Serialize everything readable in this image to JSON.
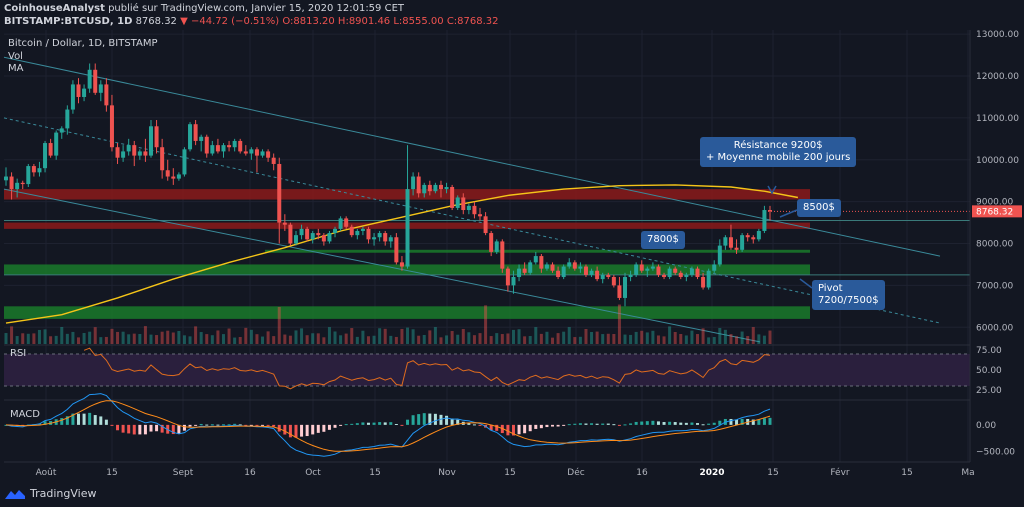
{
  "header": {
    "line1_author": "CoinhouseAnalyst",
    "line1_rest": "publié sur TradingView.com, Janvier 15, 2020 12:01:59 CET",
    "line2_symbol": "BITSTAMP:BTCUSD, 1D",
    "line2_last": "8768.32",
    "line2_change": "−44.72 (−0.51%)",
    "line2_ohlc": "O:8813.20 H:8901.46 L:8555.00 C:8768.32"
  },
  "legend": {
    "title": "Bitcoin / Dollar, 1D, BITSTAMP",
    "vol": "Vol",
    "ma": "MA",
    "rsi": "RSI",
    "macd": "MACD"
  },
  "price_label": "8768.32",
  "callouts": {
    "resistance_line1": "Résistance 9200$",
    "resistance_line2": "+ Moyenne mobile 200 jours",
    "r8500": "8500$",
    "r7800": "7800$",
    "pivot_line1": "Pivot",
    "pivot_line2": "7200/7500$"
  },
  "brand": "TradingView",
  "colors": {
    "background": "#131722",
    "up": "#26a69a",
    "down": "#ef5350",
    "ma200": "#f5c518",
    "resistance_zone": "#8b1a1a",
    "support_zone": "#1a7a2a",
    "rsi_line": "#e06c1e",
    "rsi_band": "#2a1f3d",
    "macd_line": "#2196f3",
    "signal_line": "#ff8c1a",
    "callout": "#2a5a9a"
  },
  "chart_data": [
    {
      "type": "candlestick",
      "title": "Bitcoin / Dollar, 1D, BITSTAMP",
      "x_ticks": [
        "Août",
        "15",
        "Sept",
        "16",
        "Oct",
        "15",
        "Nov",
        "15",
        "Déc",
        "16",
        "2020",
        "15",
        "Févr",
        "15",
        "Ma"
      ],
      "y_ticks": [
        6000,
        7000,
        8000,
        9000,
        10000,
        11000,
        12000,
        13000
      ],
      "ylim": [
        5600,
        13100
      ],
      "series": [
        {
          "name": "BTCUSD",
          "values": [
            [
              9510,
              9820,
              9380,
              9600
            ],
            [
              9600,
              9700,
              9050,
              9300
            ],
            [
              9300,
              9550,
              9100,
              9450
            ],
            [
              9450,
              9500,
              9300,
              9420
            ],
            [
              9420,
              9900,
              9350,
              9850
            ],
            [
              9850,
              9900,
              9600,
              9700
            ],
            [
              9700,
              9950,
              9600,
              9800
            ],
            [
              9800,
              10450,
              9700,
              10400
            ],
            [
              10400,
              10500,
              10050,
              10100
            ],
            [
              10100,
              10700,
              10000,
              10650
            ],
            [
              10650,
              10800,
              10500,
              10750
            ],
            [
              10750,
              11300,
              10600,
              11200
            ],
            [
              11200,
              11900,
              11100,
              11800
            ],
            [
              11800,
              11950,
              11350,
              11500
            ],
            [
              11500,
              11800,
              11400,
              11700
            ],
            [
              11700,
              12300,
              11600,
              12150
            ],
            [
              12150,
              12300,
              11550,
              11600
            ],
            [
              11600,
              11900,
              11400,
              11800
            ],
            [
              11800,
              11950,
              11150,
              11300
            ],
            [
              11300,
              11550,
              10200,
              10300
            ],
            [
              10300,
              10400,
              9900,
              10050
            ],
            [
              10050,
              10350,
              9950,
              10200
            ],
            [
              10200,
              10500,
              10100,
              10350
            ],
            [
              10350,
              10450,
              9850,
              10100
            ],
            [
              10100,
              10250,
              10000,
              10200
            ],
            [
              10200,
              10500,
              9950,
              10100
            ],
            [
              10100,
              10950,
              10050,
              10800
            ],
            [
              10800,
              10950,
              10150,
              10300
            ],
            [
              10300,
              10500,
              9550,
              9750
            ],
            [
              9750,
              10000,
              9500,
              9600
            ],
            [
              9600,
              9800,
              9400,
              9550
            ],
            [
              9550,
              9700,
              9500,
              9650
            ],
            [
              9650,
              10300,
              9600,
              10250
            ],
            [
              10250,
              10900,
              10200,
              10850
            ],
            [
              10850,
              10950,
              10350,
              10450
            ],
            [
              10450,
              10600,
              10200,
              10550
            ],
            [
              10550,
              10600,
              10050,
              10150
            ],
            [
              10150,
              10450,
              10100,
              10350
            ],
            [
              10350,
              10500,
              10150,
              10200
            ],
            [
              10200,
              10400,
              10050,
              10350
            ],
            [
              10350,
              10450,
              10200,
              10300
            ],
            [
              10300,
              10500,
              10200,
              10450
            ],
            [
              10450,
              10500,
              10150,
              10200
            ],
            [
              10200,
              10350,
              10100,
              10150
            ],
            [
              10150,
              10300,
              10000,
              10250
            ],
            [
              10250,
              10300,
              9700,
              10100
            ],
            [
              10100,
              10250,
              10050,
              10200
            ],
            [
              10200,
              10250,
              9950,
              10050
            ],
            [
              10050,
              10150,
              9750,
              9900
            ],
            [
              9900,
              10050,
              8000,
              8500
            ],
            [
              8500,
              8700,
              8300,
              8450
            ],
            [
              8450,
              8500,
              7950,
              8000
            ],
            [
              8000,
              8300,
              7950,
              8200
            ],
            [
              8200,
              8450,
              8100,
              8350
            ],
            [
              8350,
              8400,
              8050,
              8100
            ],
            [
              8100,
              8300,
              8000,
              8250
            ],
            [
              8250,
              8350,
              8100,
              8200
            ],
            [
              8200,
              8250,
              7950,
              8050
            ],
            [
              8050,
              8300,
              8000,
              8250
            ],
            [
              8250,
              8400,
              8150,
              8350
            ],
            [
              8350,
              8650,
              8300,
              8600
            ],
            [
              8600,
              8650,
              8350,
              8400
            ],
            [
              8400,
              8450,
              8150,
              8200
            ],
            [
              8200,
              8350,
              8100,
              8300
            ],
            [
              8300,
              8400,
              8200,
              8350
            ],
            [
              8350,
              8400,
              8000,
              8100
            ],
            [
              8100,
              8250,
              7950,
              8150
            ],
            [
              8150,
              8300,
              8050,
              8250
            ],
            [
              8250,
              8300,
              7950,
              8050
            ],
            [
              8050,
              8200,
              7900,
              8150
            ],
            [
              8150,
              8250,
              7500,
              7550
            ],
            [
              7550,
              7700,
              7350,
              7450
            ],
            [
              7450,
              10350,
              7400,
              9300
            ],
            [
              9300,
              9700,
              9150,
              9600
            ],
            [
              9600,
              9700,
              9100,
              9200
            ],
            [
              9200,
              9450,
              9100,
              9400
            ],
            [
              9400,
              9500,
              9150,
              9250
            ],
            [
              9250,
              9450,
              9200,
              9400
            ],
            [
              9400,
              9500,
              9100,
              9300
            ],
            [
              9300,
              9450,
              9200,
              9350
            ],
            [
              9350,
              9400,
              8800,
              8850
            ],
            [
              8850,
              9150,
              8800,
              9100
            ],
            [
              9100,
              9200,
              8700,
              8800
            ],
            [
              8800,
              8950,
              8700,
              8900
            ],
            [
              8900,
              9000,
              8600,
              8700
            ],
            [
              8700,
              8850,
              8550,
              8650
            ],
            [
              8650,
              8750,
              8200,
              8250
            ],
            [
              8250,
              8300,
              7700,
              7800
            ],
            [
              7800,
              8100,
              7750,
              8050
            ],
            [
              8050,
              8100,
              7300,
              7400
            ],
            [
              7400,
              7450,
              6850,
              7000
            ],
            [
              7000,
              7350,
              6800,
              7200
            ],
            [
              7200,
              7500,
              7100,
              7400
            ],
            [
              7400,
              7550,
              7250,
              7300
            ],
            [
              7300,
              7600,
              7250,
              7550
            ],
            [
              7550,
              7800,
              7500,
              7700
            ],
            [
              7700,
              7750,
              7300,
              7400
            ],
            [
              7400,
              7550,
              7350,
              7500
            ],
            [
              7500,
              7550,
              7300,
              7350
            ],
            [
              7350,
              7450,
              7150,
              7200
            ],
            [
              7200,
              7500,
              7150,
              7450
            ],
            [
              7450,
              7650,
              7400,
              7550
            ],
            [
              7550,
              7600,
              7350,
              7400
            ],
            [
              7400,
              7550,
              7300,
              7450
            ],
            [
              7450,
              7500,
              7200,
              7250
            ],
            [
              7250,
              7400,
              7200,
              7350
            ],
            [
              7350,
              7450,
              7100,
              7150
            ],
            [
              7150,
              7300,
              7050,
              7250
            ],
            [
              7250,
              7300,
              7150,
              7200
            ],
            [
              7200,
              7250,
              6950,
              7000
            ],
            [
              7000,
              7200,
              6650,
              6700
            ],
            [
              6700,
              7300,
              6500,
              7200
            ],
            [
              7200,
              7350,
              7100,
              7250
            ],
            [
              7250,
              7550,
              7200,
              7500
            ],
            [
              7500,
              7600,
              7300,
              7350
            ],
            [
              7350,
              7450,
              7200,
              7400
            ],
            [
              7400,
              7550,
              7350,
              7450
            ],
            [
              7450,
              7500,
              7200,
              7250
            ],
            [
              7250,
              7300,
              7150,
              7200
            ],
            [
              7200,
              7450,
              7150,
              7400
            ],
            [
              7400,
              7450,
              7250,
              7300
            ],
            [
              7300,
              7350,
              7150,
              7200
            ],
            [
              7200,
              7300,
              7100,
              7250
            ],
            [
              7250,
              7450,
              7200,
              7400
            ],
            [
              7400,
              7450,
              7150,
              7200
            ],
            [
              7200,
              7300,
              6900,
              6950
            ],
            [
              6950,
              7400,
              6900,
              7350
            ],
            [
              7350,
              7600,
              7300,
              7500
            ],
            [
              7500,
              8100,
              7450,
              7950
            ],
            [
              7950,
              8200,
              7850,
              8150
            ],
            [
              8150,
              8450,
              7850,
              7900
            ],
            [
              7900,
              8100,
              7750,
              7850
            ],
            [
              7850,
              8250,
              7800,
              8200
            ],
            [
              8200,
              8250,
              8050,
              8150
            ],
            [
              8150,
              8200,
              8000,
              8100
            ],
            [
              8100,
              8350,
              8050,
              8300
            ],
            [
              8300,
              8900,
              8250,
              8800
            ],
            [
              8800,
              8900,
              8550,
              8768
            ]
          ]
        }
      ],
      "ma200": [
        [
          0,
          6100
        ],
        [
          10,
          6300
        ],
        [
          20,
          6700
        ],
        [
          30,
          7150
        ],
        [
          40,
          7550
        ],
        [
          50,
          7900
        ],
        [
          60,
          8300
        ],
        [
          70,
          8600
        ],
        [
          80,
          8900
        ],
        [
          90,
          9150
        ],
        [
          100,
          9300
        ],
        [
          110,
          9380
        ],
        [
          120,
          9400
        ],
        [
          130,
          9350
        ],
        [
          136,
          9250
        ],
        [
          142,
          9100
        ]
      ],
      "zones": {
        "resistance_9200": [
          9050,
          9300
        ],
        "resistance_8500": [
          8350,
          8500
        ],
        "support_7800": [
          7780,
          7850
        ],
        "support_7200_7500": [
          7250,
          7500
        ],
        "support_6300": [
          6200,
          6500
        ]
      },
      "price_scale_label": 8768.32
    },
    {
      "type": "line",
      "title": "RSI",
      "y_ticks": [
        25,
        50,
        75
      ],
      "ylim": [
        15,
        80
      ],
      "band": [
        30,
        70
      ]
    },
    {
      "type": "bar",
      "title": "MACD",
      "y_ticks": [
        0,
        -500
      ],
      "y_tick_labels": [
        "0.00",
        "−500.00"
      ],
      "ylim": [
        -700,
        450
      ]
    }
  ]
}
